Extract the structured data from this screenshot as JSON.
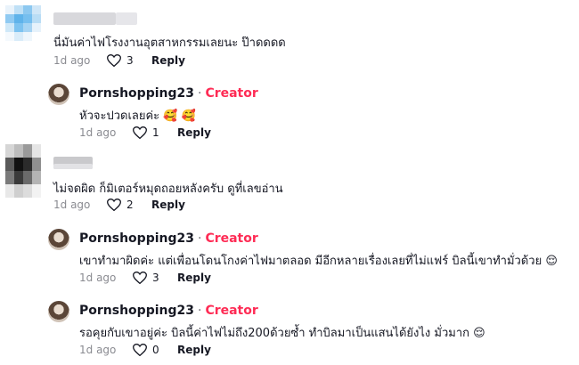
{
  "comments": [
    {
      "text": "นี่มันค่าไฟโรงงานอุตสาหกรรมเลยนะ ป๊าดดดด",
      "time": "1d ago",
      "likes": "3",
      "reply": "Reply",
      "replies": [
        {
          "username": "Pornshopping23",
          "badge": "Creator",
          "separator": "·",
          "text": "หัวจะปวดเลยค่ะ 🥰 🥰",
          "time": "1d ago",
          "likes": "1",
          "reply": "Reply"
        }
      ]
    },
    {
      "text": "ไม่จดผิด ก็มิเตอร์หมุดถอยหลังครับ ดูที่เลขอ่าน",
      "time": "1d ago",
      "likes": "2",
      "reply": "Reply",
      "replies": [
        {
          "username": "Pornshopping23",
          "badge": "Creator",
          "separator": "·",
          "text": "เขาทำมาผิดค่ะ แต่เพื่อนโดนโกงค่าไฟมาตลอด มีอีกหลายเรื่องเลยที่ไม่แฟร์ บิลนี้เขาทำมั่วด้วย 😌",
          "time": "1d ago",
          "likes": "3",
          "reply": "Reply"
        },
        {
          "username": "Pornshopping23",
          "badge": "Creator",
          "separator": "·",
          "text": "รอคุยกับเขาอยู่ค่ะ บิลนี้ค่าไฟไม่ถึง200ด้วยซ้ำ ทำบิลมาเป็นแสนได้ยังไง มั่วมาก 😌",
          "time": "1d ago",
          "likes": "0",
          "reply": "Reply"
        }
      ]
    }
  ],
  "icons": {
    "like": "heart-outline-icon"
  },
  "colors": {
    "creator": "#fe2c55",
    "meta": "#8a8b91",
    "text": "#161823"
  }
}
